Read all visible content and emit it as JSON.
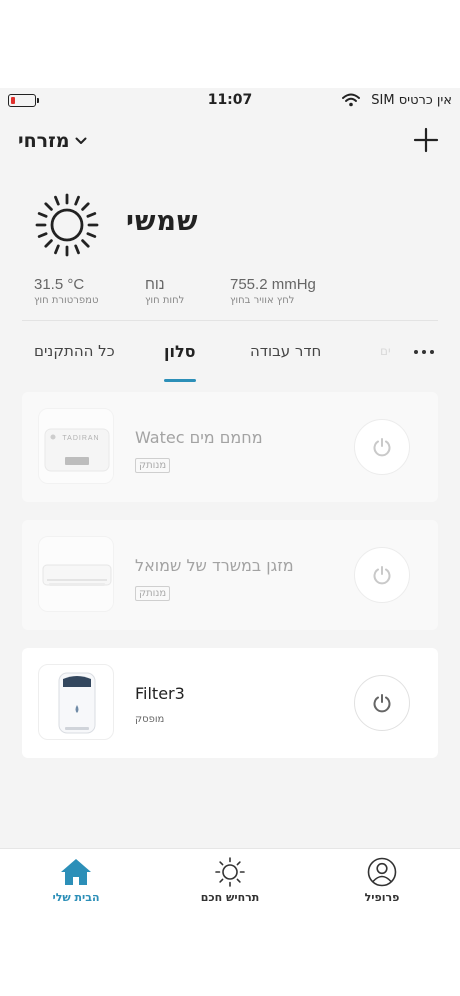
{
  "status_bar": {
    "time": "11:07",
    "carrier": "אין כרטיס SIM"
  },
  "header": {
    "location": "מזרחי"
  },
  "weather": {
    "condition": "שמשי",
    "stats": [
      {
        "value": "31.5 °C",
        "label": "טמפרטורת חוץ"
      },
      {
        "value": "נוח",
        "label": "לחות חוץ"
      },
      {
        "value": "755.2 mmHg",
        "label": "לחץ אוויר בחוץ"
      }
    ]
  },
  "tabs": {
    "items": [
      "כל ההתקנים",
      "סלון",
      "חדר עבודה",
      "ים"
    ],
    "active": "סלון"
  },
  "devices": [
    {
      "name": "Watec מחמם מים",
      "status": "מנותק",
      "brand": "TADIRAN",
      "online": false
    },
    {
      "name": "מזגן במשרד של שמואל",
      "status": "מנותק",
      "online": false
    },
    {
      "name": "Filter3",
      "status": "מופסק",
      "online": true
    }
  ],
  "bottom_nav": {
    "items": [
      {
        "label": "הבית שלי",
        "icon": "home-icon",
        "active": true
      },
      {
        "label": "תרחיש חכם",
        "icon": "sun-icon",
        "active": false
      },
      {
        "label": "פרופיל",
        "icon": "profile-icon",
        "active": false
      }
    ]
  },
  "colors": {
    "accent": "#2c8fb8",
    "battery_low": "#e0312d",
    "background": "#f4f4f4"
  }
}
